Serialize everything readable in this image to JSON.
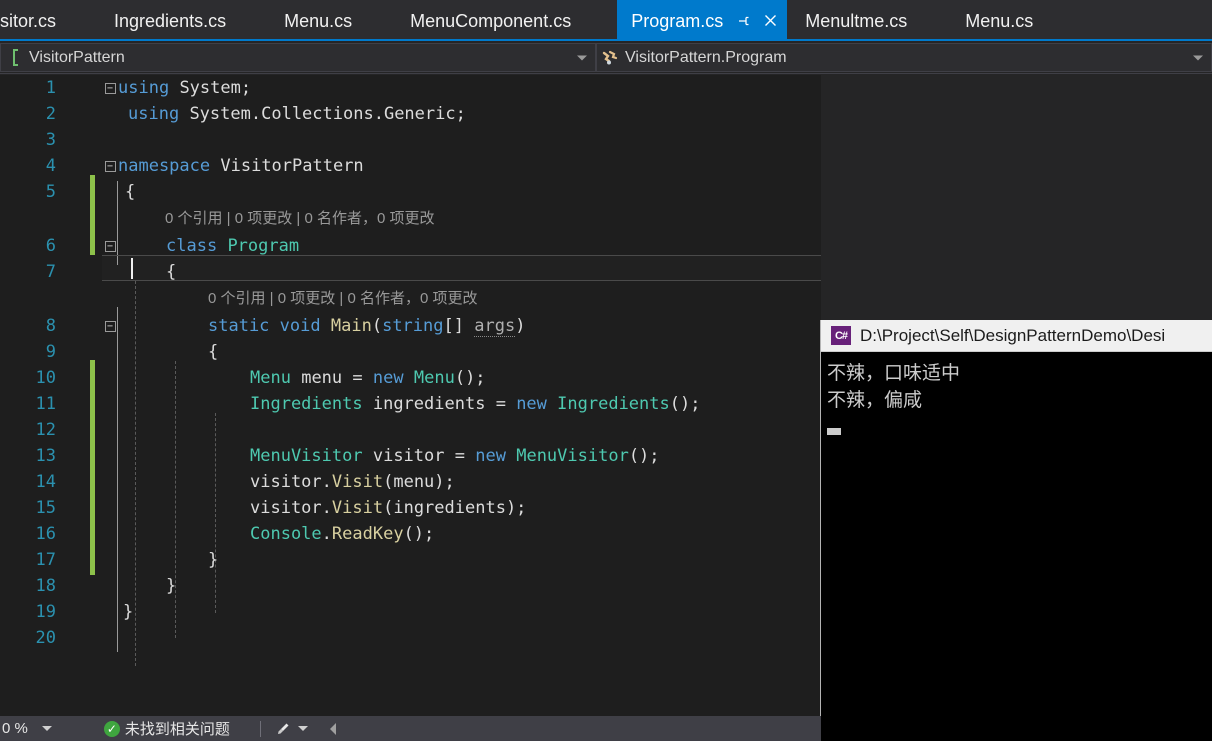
{
  "tabs": [
    {
      "label": "sitor.cs",
      "active": false
    },
    {
      "label": "Ingredients.cs",
      "active": false
    },
    {
      "label": "Menu.cs",
      "active": false
    },
    {
      "label": "MenuComponent.cs",
      "active": false
    },
    {
      "label": "Program.cs",
      "active": true,
      "pin_icon": "pin-icon",
      "close_icon": "close-icon"
    },
    {
      "label": "Menultme.cs",
      "active": false
    },
    {
      "label": "Menu.cs",
      "active": false
    }
  ],
  "navbar": {
    "project_icon": "namespace-icon",
    "project": "VisitorPattern",
    "member_icon": "class-icon",
    "member": "VisitorPattern.Program",
    "dropdown_icon": "chevron-down-icon"
  },
  "editor": {
    "lines": [
      {
        "no": "1",
        "fold": "minus",
        "text": "using System;"
      },
      {
        "no": "2",
        "text": "using System.Collections.Generic;"
      },
      {
        "no": "3",
        "text": ""
      },
      {
        "no": "4",
        "fold": "minus",
        "text": "namespace VisitorPattern"
      },
      {
        "no": "5",
        "text": "{",
        "current": true
      },
      {
        "no": "",
        "codelens": "0 个引用 | 0 项更改 | 0 名作者，0 项更改"
      },
      {
        "no": "6",
        "fold": "minus",
        "text": "    class Program"
      },
      {
        "no": "7",
        "text": "    {"
      },
      {
        "no": "",
        "codelens": "0 个引用 | 0 项更改 | 0 名作者，0 项更改"
      },
      {
        "no": "8",
        "fold": "minus",
        "text": "        static void Main(string[] args)"
      },
      {
        "no": "9",
        "text": "        {"
      },
      {
        "no": "10",
        "text": "            Menu menu = new Menu();"
      },
      {
        "no": "11",
        "text": "            Ingredients ingredients = new Ingredients();"
      },
      {
        "no": "12",
        "text": ""
      },
      {
        "no": "13",
        "text": "            MenuVisitor visitor = new MenuVisitor();"
      },
      {
        "no": "14",
        "text": "            visitor.Visit(menu);"
      },
      {
        "no": "15",
        "text": "            visitor.Visit(ingredients);"
      },
      {
        "no": "16",
        "text": "            Console.ReadKey();"
      },
      {
        "no": "17",
        "text": "        }"
      },
      {
        "no": "18",
        "text": "    }"
      },
      {
        "no": "19",
        "text": "}"
      },
      {
        "no": "20",
        "text": ""
      }
    ]
  },
  "console": {
    "icon": "csharp-icon",
    "title": "D:\\Project\\Self\\DesignPatternDemo\\Desi",
    "output": [
      "不辣，口味适中",
      "不辣，偏咸"
    ],
    "caret": "block-cursor"
  },
  "statusbar": {
    "zoom": "0 %",
    "zoom_dropdown_icon": "chevron-down-icon",
    "status_icon": "check-circle-icon",
    "status_text": "未找到相关问题",
    "brush_icon": "brush-icon",
    "brush_dropdown_icon": "chevron-down-icon",
    "collapse_icon": "chevron-left-icon"
  },
  "colors": {
    "accent": "#007acc",
    "editor_bg": "#1e1e1e",
    "chrome_bg": "#2d2d30",
    "status_bg": "#3f3f46",
    "keyword": "#569cd6",
    "type": "#4ec9b0",
    "method": "#d8d0a0",
    "linenumber": "#2b91af",
    "changebar": "#8dc14a",
    "console_fg": "#cccccc"
  }
}
